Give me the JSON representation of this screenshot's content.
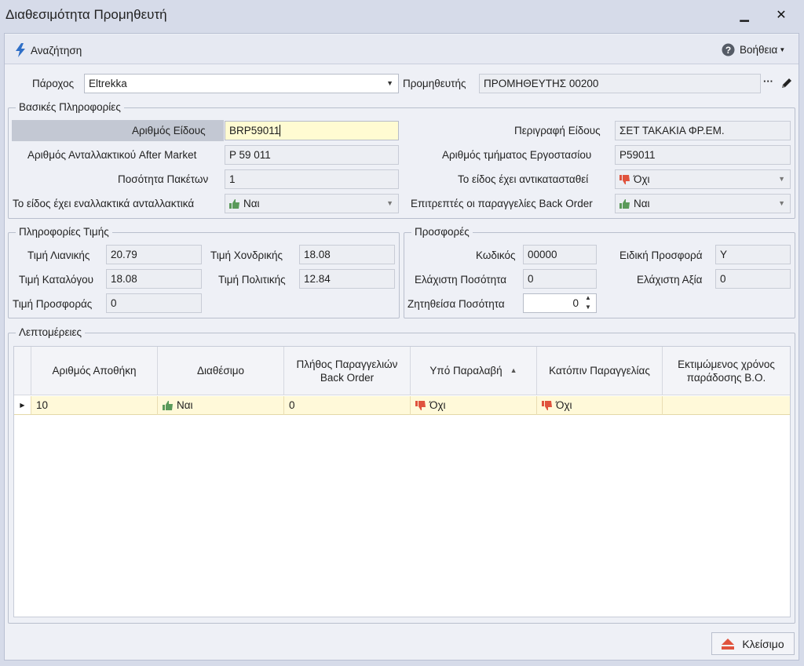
{
  "window": {
    "title": "Διαθεσιμότητα Προμηθευτή"
  },
  "toolbar": {
    "search_label": "Αναζήτηση",
    "help_label": "Βοήθεια"
  },
  "provider": {
    "label": "Πάροχος",
    "value": "Eltrekka"
  },
  "supplier": {
    "label": "Προμηθευτής",
    "value": "ΠΡΟΜΗΘΕΥΤΗΣ 00200",
    "more": "···"
  },
  "basic": {
    "title": "Βασικές Πληροφορίες",
    "item_no_label": "Αριθμός Είδους",
    "item_no": "BRP59011",
    "aftermarket_label": "Αριθμός Ανταλλακτικού After Market",
    "aftermarket": "P 59 011",
    "pkg_qty_label": "Ποσότητα Πακέτων",
    "pkg_qty": "1",
    "alternatives_label": "Το είδος έχει εναλλακτικά ανταλλακτικά",
    "alternatives": "Ναι",
    "description_label": "Περιγραφή Είδους",
    "description": "ΣΕΤ ΤΑΚΑΚΙΑ ΦΡ.ΕΜ.",
    "factory_label": "Αριθμός τμήματος Εργοστασίου",
    "factory": "P59011",
    "replaced_label": "Το είδος έχει αντικατασταθεί",
    "replaced": "Όχι",
    "backorder_label": "Επιτρεπτές οι παραγγελίες Back Order",
    "backorder": "Ναι"
  },
  "pricing": {
    "title": "Πληροφορίες Τιμής",
    "retail_label": "Τιμή Λιανικής",
    "retail": "20.79",
    "wholesale_label": "Τιμή Χονδρικής",
    "wholesale": "18.08",
    "catalog_label": "Τιμή Καταλόγου",
    "catalog": "18.08",
    "policy_label": "Τιμή Πολιτικής",
    "policy": "12.84",
    "offer_label": "Τιμή Προσφοράς",
    "offer": "0"
  },
  "offers": {
    "title": "Προσφορές",
    "code_label": "Κωδικός",
    "code": "00000",
    "special_label": "Ειδική Προσφορά",
    "special": "Y",
    "min_qty_label": "Ελάχιστη Ποσότητα",
    "min_qty": "0",
    "min_value_label": "Ελάχιστη Αξία",
    "min_value": "0",
    "req_qty_label": "Ζητηθείσα Ποσότητα",
    "req_qty": "0"
  },
  "details": {
    "title": "Λεπτομέρειες",
    "columns": [
      "Αριθμός Αποθήκη",
      "Διαθέσιμο",
      "Πλήθος Παραγγελιών Back Order",
      "Υπό Παραλαβή",
      "Κατόπιν Παραγγελίας",
      "Εκτιμώμενος χρόνος παράδοσης B.O."
    ],
    "rows": [
      {
        "warehouse": "10",
        "available": "Ναι",
        "backorders": "0",
        "receiving": "Όχι",
        "on_order": "Όχι",
        "eta": ""
      }
    ]
  },
  "footer": {
    "close_label": "Κλείσιμο"
  },
  "colors": {
    "accent": "#2f6fc7",
    "thumb_up": "#5a9a5a",
    "thumb_down": "#e0533d",
    "highlight_row": "#fff9d9"
  }
}
